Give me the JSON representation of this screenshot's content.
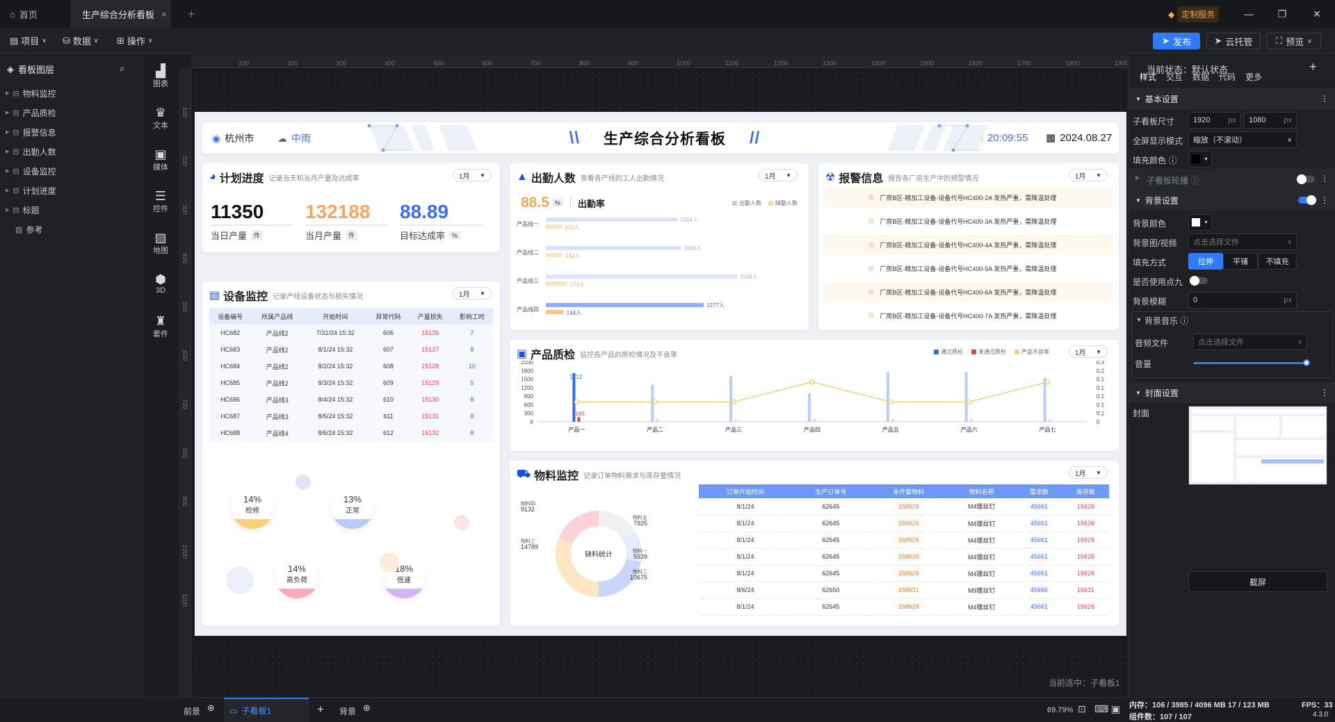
{
  "tabs": {
    "home": "首页",
    "active": "生产综合分析看板",
    "plus": "+"
  },
  "window": {
    "custom_service": "定制服务"
  },
  "toolbar": {
    "project": "项目",
    "data": "数据",
    "operate": "操作",
    "publish": "发布",
    "cloud": "云托管",
    "preview": "预览"
  },
  "layers": {
    "title": "看板图层",
    "items": [
      "物料监控",
      "产品质检",
      "报警信息",
      "出勤人数",
      "设备监控",
      "计划进度",
      "标题"
    ],
    "ref": "参考"
  },
  "sidebar": [
    "图表",
    "文本",
    "媒体",
    "控件",
    "地图",
    "3D",
    "套件"
  ],
  "ruler_h": [
    "100",
    "200",
    "300",
    "400",
    "500",
    "600",
    "700",
    "800",
    "900",
    "1000",
    "1100",
    "1200",
    "1300",
    "1400",
    "1500",
    "1600",
    "1700",
    "1800",
    "1900"
  ],
  "ruler_v": [
    "100",
    "200",
    "300",
    "400",
    "500",
    "600",
    "700",
    "800",
    "900",
    "1000",
    "1100"
  ],
  "header": {
    "city": "杭州市",
    "weather": "中雨",
    "title": "生产综合分析看板",
    "time": "20:09:55",
    "date": "2024.08.27"
  },
  "plan": {
    "title": "计划进度",
    "sub": "记录当天和当月产量及达成率",
    "month": "1月",
    "kpis": [
      {
        "value": "11350",
        "label": "当日产量",
        "unit": "件"
      },
      {
        "value": "132188",
        "label": "当月产量",
        "unit": "件"
      },
      {
        "value": "88.89",
        "label": "目标达成率",
        "unit": "%"
      }
    ]
  },
  "attendance": {
    "title": "出勤人数",
    "sub": "查看各产线的工人出勤情况",
    "month": "1月",
    "rate_value": "88.5",
    "rate_unit": "%",
    "rate_label": "出勤率",
    "legend": [
      "出勤人数",
      "缺勤人数"
    ]
  },
  "alarm": {
    "title": "报警信息",
    "sub": "报告各厂房生产中的预警情况",
    "month": "1月",
    "items": [
      "厂房B区-精加工设备-设备代号HC400-2A 发热严重，需降温处理",
      "厂房B区-精加工设备-设备代号HC400-3A 发热严重，需降温处理",
      "厂房B区-精加工设备-设备代号HC400-4A 发热严重，需降温处理",
      "厂房B区-精加工设备-设备代号HC400-5A 发热严重，需降温处理",
      "厂房B区-精加工设备-设备代号HC400-6A 发热严重，需降温处理",
      "厂房B区-精加工设备-设备代号HC400-7A 发热严重，需降温处理"
    ]
  },
  "device": {
    "title": "设备监控",
    "sub": "记录产线设备状态与损失情况",
    "month": "1月",
    "headers": [
      "设备编号",
      "所属产品线",
      "开始时间",
      "异常代码",
      "产量损失",
      "影响工时"
    ],
    "rows": [
      [
        "HC682",
        "产品线2",
        "7/31/24 15:32",
        "606",
        "15126",
        "7"
      ],
      [
        "HC683",
        "产品线2",
        "8/1/24 15:32",
        "607",
        "15127",
        "8"
      ],
      [
        "HC684",
        "产品线2",
        "8/2/24 15:32",
        "608",
        "15128",
        "10"
      ],
      [
        "HC685",
        "产品线2",
        "8/3/24 15:32",
        "609",
        "15129",
        "5"
      ],
      [
        "HC686",
        "产品线3",
        "8/4/24 15:32",
        "610",
        "15130",
        "8"
      ],
      [
        "HC687",
        "产品线3",
        "8/5/24 15:32",
        "611",
        "15131",
        "8"
      ],
      [
        "HC688",
        "产品线4",
        "8/6/24 15:32",
        "612",
        "15132",
        "8"
      ]
    ],
    "bubbles": [
      {
        "pct": "14%",
        "label": "检修"
      },
      {
        "pct": "13%",
        "label": "正常"
      },
      {
        "pct": "14%",
        "label": "高负荷"
      },
      {
        "pct": "18%",
        "label": "低速"
      }
    ]
  },
  "quality": {
    "title": "产品质检",
    "sub": "监控各产品的质检情况及不良率",
    "month": "1月",
    "legend": [
      "通过质检",
      "未通过质检",
      "产品不良率"
    ]
  },
  "material": {
    "title": "物料监控",
    "sub": "记录订单物料需求与库存量情况",
    "month": "1月",
    "center": "缺料统计",
    "headers": [
      "订单开始时间",
      "生产订单号",
      "未齐套物料",
      "物料名称",
      "需求数",
      "库存数"
    ],
    "rows": [
      [
        "8/1/24",
        "62645",
        "158626",
        "M4镙丝钉",
        "45661",
        "15626"
      ],
      [
        "8/1/24",
        "62645",
        "158626",
        "M4镙丝钉",
        "45661",
        "15626"
      ],
      [
        "8/1/24",
        "62645",
        "158626",
        "M4镙丝钉",
        "45661",
        "15626"
      ],
      [
        "8/1/24",
        "62645",
        "158626",
        "M4镙丝钉",
        "45661",
        "15626"
      ],
      [
        "8/1/24",
        "62645",
        "158626",
        "M4镙丝钉",
        "45661",
        "15626"
      ],
      [
        "8/6/24",
        "62650",
        "158631",
        "M9镙丝钉",
        "45666",
        "15631"
      ],
      [
        "8/1/24",
        "62645",
        "158626",
        "M4镙丝钉",
        "45661",
        "15626"
      ]
    ]
  },
  "chart_data": [
    {
      "type": "bar",
      "title": "出勤人数",
      "categories": [
        "产品线一",
        "产品线二",
        "产品线三",
        "产品线四"
      ],
      "series": [
        {
          "name": "出勤人数",
          "values": [
            1064,
            1096,
            1548,
            1277
          ],
          "labels": [
            "1064人",
            "1096人",
            "1548人",
            "1277人"
          ]
        },
        {
          "name": "缺勤人数",
          "values": [
            130,
            134,
            173,
            144
          ],
          "labels": [
            "130人",
            "134人",
            "173人",
            "144人"
          ]
        }
      ],
      "xlim": [
        0,
        1800
      ]
    },
    {
      "type": "bar",
      "title": "产品质检",
      "categories": [
        "产品一",
        "产品二",
        "产品三",
        "产品四",
        "产品五",
        "产品六",
        "产品七"
      ],
      "series": [
        {
          "name": "通过质检",
          "values": [
            1712,
            1300,
            1600,
            1000,
            1750,
            1750,
            1550
          ]
        },
        {
          "name": "未通过质检",
          "values": [
            165,
            80,
            60,
            90,
            90,
            70,
            70
          ]
        },
        {
          "name": "产品不良率",
          "type": "line",
          "values": [
            0.1,
            0.1,
            0.1,
            0.2,
            0.1,
            0.1,
            0.2
          ]
        }
      ],
      "y_left_ticks": [
        "2100",
        "1800",
        "1500",
        "1200",
        "900",
        "600",
        "300",
        "0"
      ],
      "y_right_ticks": [
        "0.3",
        "0.2",
        "0.1",
        "0.1",
        "0.1",
        "0.1",
        "0.1",
        "0"
      ],
      "ylim": [
        0,
        2100
      ],
      "y2lim": [
        0,
        0.3
      ],
      "labels": {
        "pass_first": "1712",
        "fail_first": "165"
      }
    },
    {
      "type": "pie",
      "title": "缺料统计",
      "slices": [
        {
          "name": "物料一",
          "value": 5539
        },
        {
          "name": "物料二",
          "value": 10675
        },
        {
          "name": "物料三",
          "value": 14789
        },
        {
          "name": "物料四",
          "value": 9132
        },
        {
          "name": "物料五",
          "value": 7925
        }
      ],
      "labels": [
        {
          "name": "物料四",
          "value": "9132"
        },
        {
          "name": "物料三",
          "value": "14789"
        },
        {
          "name": "物料五",
          "value": "7925"
        },
        {
          "name": "物料一",
          "value": "5539"
        },
        {
          "name": "物料二",
          "value": "10675"
        }
      ]
    }
  ],
  "canvas": {
    "current": "当前选中：子看板1"
  },
  "right": {
    "state_label": "当前状态：",
    "state_value": "默认状态",
    "tabs": [
      "样式",
      "交互",
      "数据",
      "代码",
      "更多"
    ],
    "basic": "基本设置",
    "size_label": "子看板尺寸",
    "width": "1920",
    "height": "1080",
    "px": "px",
    "fullscreen_label": "全屏显示模式",
    "fullscreen_value": "缩放（不滚动）",
    "fill_label": "填充颜色",
    "carousel": "子看板轮播",
    "bg_section": "背景设置",
    "bg_color_label": "背景颜色",
    "bg_img_label": "背景图/视频",
    "bg_img_value": "点击选择文件",
    "fill_mode_label": "填充方式",
    "fill_modes": [
      "拉伸",
      "平铺",
      "不填充"
    ],
    "dot_label": "是否使用点九",
    "blur_label": "背景模糊",
    "blur_value": "0",
    "music_section": "背景音乐",
    "audio_label": "音频文件",
    "audio_value": "点击选择文件",
    "volume_label": "音量",
    "cover_section": "封面设置",
    "cover_label": "封面",
    "screenshot": "截屏"
  },
  "bottom": {
    "front": "前景",
    "sub1": "子看板1",
    "back": "背景",
    "zoom": "69.79%",
    "memory": "内存：106 / 3985 / 4096 MB  17 / 123 MB",
    "components": "组件数：107 / 107",
    "fps": "FPS：33",
    "version": "4.3.0"
  }
}
